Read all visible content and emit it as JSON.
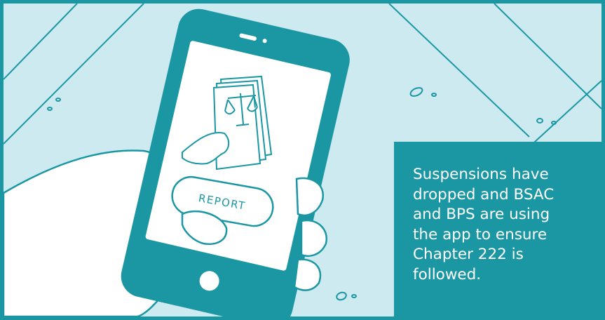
{
  "colors": {
    "background": "#cdeaf0",
    "accent": "#1b97a4",
    "screen": "#ffffff",
    "ink": "#1b97a4"
  },
  "phone": {
    "report_button_label": "REPORT",
    "icon": "scales-of-justice-document-icon"
  },
  "caption": {
    "text": "Suspensions have\ndropped and BSAC\nand BPS are using\nthe app to ensure\nChapter 222 is\nfollowed."
  }
}
